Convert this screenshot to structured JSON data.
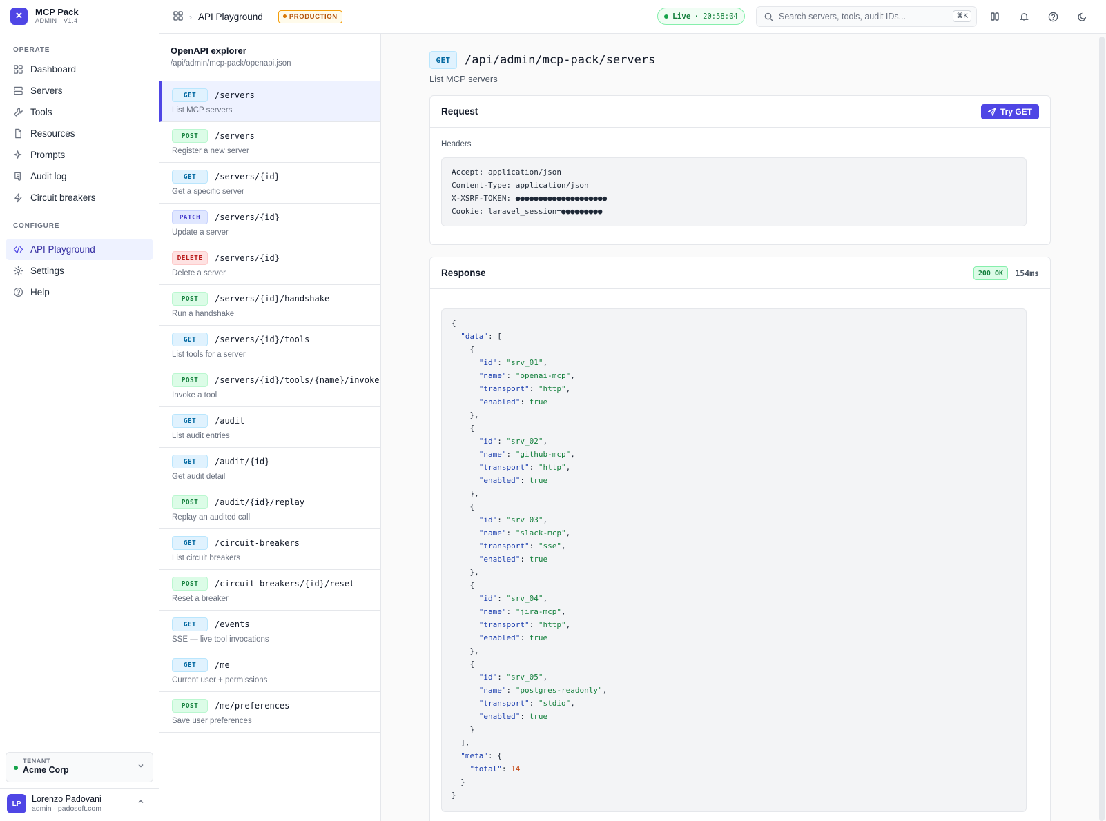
{
  "brand": {
    "name": "MCP Pack",
    "version": "ADMIN · V1.4"
  },
  "nav": {
    "sections": [
      {
        "label": "OPERATE",
        "items": [
          {
            "label": "Dashboard",
            "icon": "dashboard-icon"
          },
          {
            "label": "Servers",
            "icon": "server-icon"
          },
          {
            "label": "Tools",
            "icon": "wrench-icon"
          },
          {
            "label": "Resources",
            "icon": "file-icon"
          },
          {
            "label": "Prompts",
            "icon": "sparkle-icon"
          },
          {
            "label": "Audit log",
            "icon": "scroll-icon"
          },
          {
            "label": "Circuit breakers",
            "icon": "bolt-icon"
          }
        ]
      },
      {
        "label": "CONFIGURE",
        "items": [
          {
            "label": "API Playground",
            "icon": "code-icon",
            "active": true
          },
          {
            "label": "Settings",
            "icon": "gear-icon"
          },
          {
            "label": "Help",
            "icon": "help-icon"
          }
        ]
      }
    ]
  },
  "tenant": {
    "label": "TENANT",
    "name": "Acme Corp"
  },
  "user": {
    "initials": "LP",
    "name": "Lorenzo Padovani",
    "email": "admin · padosoft.com"
  },
  "topbar": {
    "breadcrumb": "API Playground",
    "env_badge": "PRODUCTION",
    "live_label": "Live",
    "live_time": "· 20:58:04",
    "search_placeholder": "Search servers, tools, audit IDs...",
    "search_shortcut": "⌘K"
  },
  "explorer": {
    "title": "OpenAPI explorer",
    "spec_path": "/api/admin/mcp-pack/openapi.json",
    "endpoints": [
      {
        "method": "GET",
        "path": "/servers",
        "desc": "List MCP servers",
        "selected": true
      },
      {
        "method": "POST",
        "path": "/servers",
        "desc": "Register a new server"
      },
      {
        "method": "GET",
        "path": "/servers/{id}",
        "desc": "Get a specific server"
      },
      {
        "method": "PATCH",
        "path": "/servers/{id}",
        "desc": "Update a server"
      },
      {
        "method": "DELETE",
        "path": "/servers/{id}",
        "desc": "Delete a server"
      },
      {
        "method": "POST",
        "path": "/servers/{id}/handshake",
        "desc": "Run a handshake"
      },
      {
        "method": "GET",
        "path": "/servers/{id}/tools",
        "desc": "List tools for a server"
      },
      {
        "method": "POST",
        "path": "/servers/{id}/tools/{name}/invoke",
        "desc": "Invoke a tool"
      },
      {
        "method": "GET",
        "path": "/audit",
        "desc": "List audit entries"
      },
      {
        "method": "GET",
        "path": "/audit/{id}",
        "desc": "Get audit detail"
      },
      {
        "method": "POST",
        "path": "/audit/{id}/replay",
        "desc": "Replay an audited call"
      },
      {
        "method": "GET",
        "path": "/circuit-breakers",
        "desc": "List circuit breakers"
      },
      {
        "method": "POST",
        "path": "/circuit-breakers/{id}/reset",
        "desc": "Reset a breaker"
      },
      {
        "method": "GET",
        "path": "/events",
        "desc": "SSE — live tool invocations"
      },
      {
        "method": "GET",
        "path": "/me",
        "desc": "Current user + permissions"
      },
      {
        "method": "POST",
        "path": "/me/preferences",
        "desc": "Save user preferences"
      }
    ]
  },
  "detail": {
    "method": "GET",
    "path": "/api/admin/mcp-pack/servers",
    "summary": "List MCP servers",
    "request": {
      "title": "Request",
      "try_label": "Try GET",
      "headers_label": "Headers",
      "headers": [
        "Accept: application/json",
        "Content-Type: application/json",
        "X-XSRF-TOKEN: ●●●●●●●●●●●●●●●●●●●●",
        "Cookie: laravel_session=●●●●●●●●●"
      ]
    },
    "response": {
      "title": "Response",
      "status": "200 OK",
      "latency": "154ms",
      "body": {
        "data": [
          {
            "id": "srv_01",
            "name": "openai-mcp",
            "transport": "http",
            "enabled": true
          },
          {
            "id": "srv_02",
            "name": "github-mcp",
            "transport": "http",
            "enabled": true
          },
          {
            "id": "srv_03",
            "name": "slack-mcp",
            "transport": "sse",
            "enabled": true
          },
          {
            "id": "srv_04",
            "name": "jira-mcp",
            "transport": "http",
            "enabled": true
          },
          {
            "id": "srv_05",
            "name": "postgres-readonly",
            "transport": "stdio",
            "enabled": true
          }
        ],
        "meta": {
          "total": 14
        }
      }
    }
  },
  "colors": {
    "accent": "#4f46e5",
    "live": "#16a34a",
    "production": "#d97706"
  }
}
